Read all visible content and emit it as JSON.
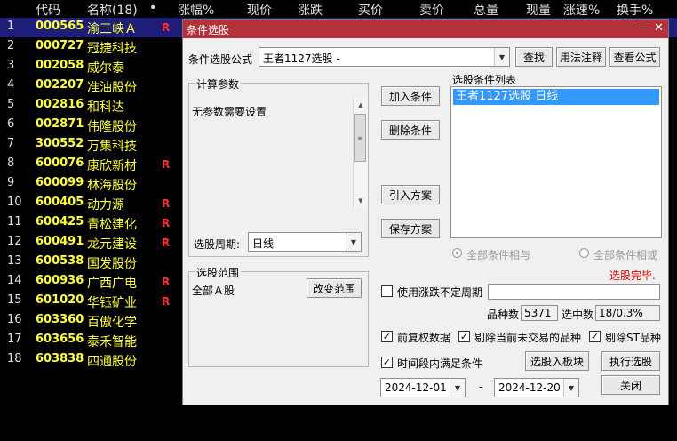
{
  "header": {
    "columns": [
      "代码",
      "名称(18)",
      "•",
      "涨幅%",
      "现价",
      "涨跌",
      "买价",
      "卖价",
      "总量",
      "现量",
      "涨速%",
      "换手%"
    ]
  },
  "stocks": [
    {
      "idx": "1",
      "code": "000565",
      "name": "渝三峡Ａ",
      "flag": "R"
    },
    {
      "idx": "2",
      "code": "000727",
      "name": "冠捷科技",
      "flag": ""
    },
    {
      "idx": "3",
      "code": "002058",
      "name": "威尔泰",
      "flag": ""
    },
    {
      "idx": "4",
      "code": "002207",
      "name": "准油股份",
      "flag": ""
    },
    {
      "idx": "5",
      "code": "002816",
      "name": "和科达",
      "flag": ""
    },
    {
      "idx": "6",
      "code": "002871",
      "name": "伟隆股份",
      "flag": ""
    },
    {
      "idx": "7",
      "code": "300552",
      "name": "万集科技",
      "flag": ""
    },
    {
      "idx": "8",
      "code": "600076",
      "name": "康欣新材",
      "flag": "R"
    },
    {
      "idx": "9",
      "code": "600099",
      "name": "林海股份",
      "flag": ""
    },
    {
      "idx": "10",
      "code": "600405",
      "name": "动力源",
      "flag": "R"
    },
    {
      "idx": "11",
      "code": "600425",
      "name": "青松建化",
      "flag": "R"
    },
    {
      "idx": "12",
      "code": "600491",
      "name": "龙元建设",
      "flag": "R"
    },
    {
      "idx": "13",
      "code": "600538",
      "name": "国发股份",
      "flag": ""
    },
    {
      "idx": "14",
      "code": "600936",
      "name": "广西广电",
      "flag": "R"
    },
    {
      "idx": "15",
      "code": "601020",
      "name": "华钰矿业",
      "flag": "R"
    },
    {
      "idx": "16",
      "code": "603360",
      "name": "百傲化学",
      "flag": ""
    },
    {
      "idx": "17",
      "code": "603656",
      "name": "泰禾智能",
      "flag": ""
    },
    {
      "idx": "18",
      "code": "603838",
      "name": "四通股份",
      "flag": ""
    }
  ],
  "dialog": {
    "title": "条件选股",
    "minimize": "—",
    "close": "✕",
    "formula_label": "条件选股公式",
    "formula_value": "王者1127选股 -",
    "find_btn": "查找",
    "usage_btn": "用法注释",
    "view_btn": "查看公式",
    "params_group": "计算参数",
    "params_text": "无参数需要设置",
    "period_label": "选股周期:",
    "period_value": "日线",
    "add_btn": "加入条件",
    "delete_btn": "删除条件",
    "import_btn": "引入方案",
    "save_btn": "保存方案",
    "cond_list_label": "选股条件列表",
    "cond_item": "王者1127选股  日线",
    "radio_and": "全部条件相与",
    "radio_or": "全部条件相或",
    "status": "选股完毕.",
    "range_group": "选股范围",
    "range_value": "全部Ａ股",
    "change_range_btn": "改变范围",
    "use_change_label": "使用涨跌不定周期",
    "count_label": "品种数",
    "count_value": "5371",
    "selected_label": "选中数",
    "selected_value": "18/0.3%",
    "opt_fq": "前复权数据",
    "opt_skip": "剔除当前未交易的品种",
    "opt_st": "剔除ST品种",
    "opt_period": "时间段内满足条件",
    "to_block_btn": "选股入板块",
    "execute_btn": "执行选股",
    "close_btn": "关闭",
    "date_from": "2024-12-01",
    "date_sep": "-",
    "date_to": "2024-12-20",
    "check_mark": "✓"
  }
}
